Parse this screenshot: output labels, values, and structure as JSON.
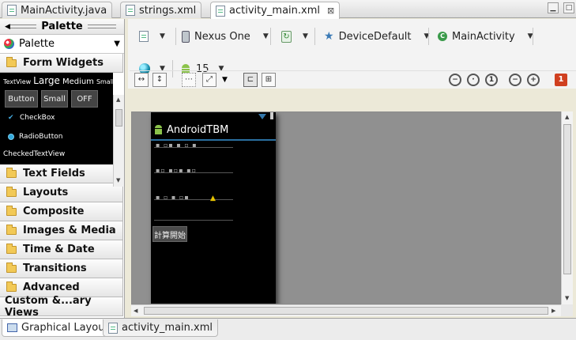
{
  "editor_tabs": [
    {
      "label": "MainActivity.java",
      "active": false
    },
    {
      "label": "strings.xml",
      "active": false
    },
    {
      "label": "activity_main.xml",
      "active": true
    }
  ],
  "palette": {
    "title": "Palette",
    "dropdown_label": "Palette",
    "open_category": "Form Widgets",
    "form_widgets_preview": {
      "textview": "TextView",
      "large": "Large",
      "medium": "Medium",
      "small": "Small",
      "button": "Button",
      "small_button": "Small",
      "toggle": "OFF",
      "checkbox": "CheckBox",
      "radio": "RadioButton",
      "checked_textview": "CheckedTextView"
    },
    "categories": [
      "Text Fields",
      "Layouts",
      "Composite",
      "Images & Media",
      "Time & Date",
      "Transitions",
      "Advanced",
      "Custom &...ary Views"
    ]
  },
  "toolbar": {
    "device": "Nexus One",
    "theme": "DeviceDefault",
    "activity": "MainActivity",
    "api_level": "15",
    "lint_count": "1"
  },
  "device_preview": {
    "app_title": "AndroidTBM",
    "start_button": "計算開始"
  },
  "bottom_tabs": [
    {
      "label": "Graphical Layout",
      "active": true
    },
    {
      "label": "activity_main.xml",
      "active": false
    }
  ]
}
